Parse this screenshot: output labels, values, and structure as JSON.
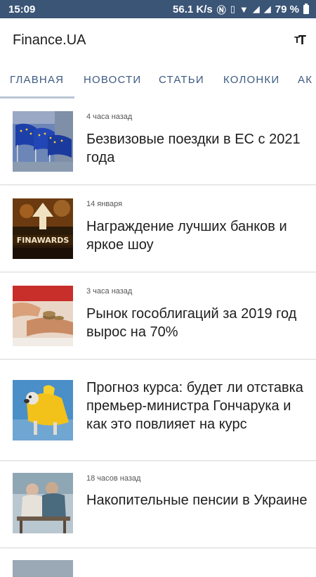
{
  "status_bar": {
    "time": "15:09",
    "speed": "56.1 K/s",
    "battery": "79 %"
  },
  "app_bar": {
    "title": "Finance.UA",
    "font_icon_large": "T",
    "font_icon_small": "T"
  },
  "tabs": [
    {
      "label": "ГЛАВНАЯ",
      "active": true
    },
    {
      "label": "НОВОСТИ",
      "active": false
    },
    {
      "label": "СТАТЬИ",
      "active": false
    },
    {
      "label": "КОЛОНКИ",
      "active": false
    },
    {
      "label": "АК",
      "active": false
    }
  ],
  "articles": [
    {
      "time": "4 часа назад",
      "title": "Безвизовые поездки в ЕС с 2021 года",
      "image": "eu-flags"
    },
    {
      "time": "14 января",
      "title": "Награждение лучших банков и яркое шоу",
      "image": "finawards"
    },
    {
      "time": "3 часа назад",
      "title": "Рынок гособлигаций за 2019 год вырос на 70%",
      "image": "coins-hands"
    },
    {
      "time": "",
      "title": "Прогноз курса: будет ли отставка премьер-министра Гончарука и как это повлияет на курс",
      "image": "dog-raincoat"
    },
    {
      "time": "18 часов назад",
      "title": "Накопительные пенсии в Украине",
      "image": "elderly-couple"
    }
  ],
  "colors": {
    "status_bar_bg": "#3b5577",
    "tab_text": "#3d5a80",
    "tab_indicator": "#b9c6d6"
  }
}
